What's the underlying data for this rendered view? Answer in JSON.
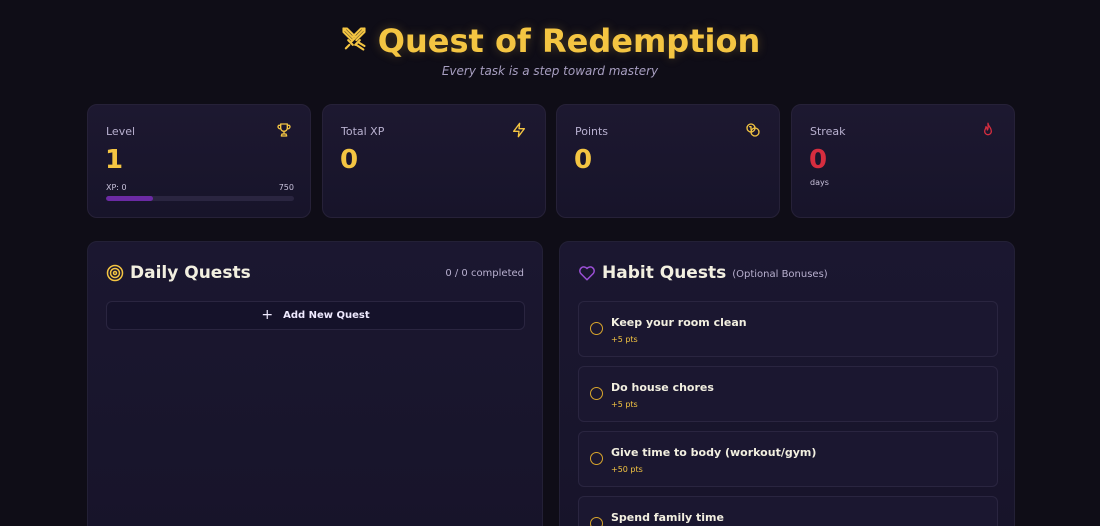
{
  "header": {
    "title": "Quest of Redemption",
    "subtitle": "Every task is a step toward mastery",
    "icon": "crossed-swords-icon"
  },
  "stats": {
    "level": {
      "label": "Level",
      "value": "1",
      "icon": "trophy-icon",
      "xp_label": "XP: 0",
      "xp_max": "750",
      "xp_progress": 0.25
    },
    "total_xp": {
      "label": "Total XP",
      "value": "0",
      "icon": "lightning-icon"
    },
    "points": {
      "label": "Points",
      "value": "0",
      "icon": "coins-icon"
    },
    "streak": {
      "label": "Streak",
      "value": "0",
      "unit": "days",
      "icon": "flame-icon"
    }
  },
  "daily": {
    "title": "Daily Quests",
    "icon": "target-icon",
    "completed": "0 / 0 completed",
    "add_label": "Add New Quest"
  },
  "habits": {
    "title": "Habit Quests",
    "note": "(Optional Bonuses)",
    "icon": "heart-icon",
    "items": [
      {
        "name": "Keep your room clean",
        "points": "+5 pts"
      },
      {
        "name": "Do house chores",
        "points": "+5 pts"
      },
      {
        "name": "Give time to body (workout/gym)",
        "points": "+50 pts"
      },
      {
        "name": "Spend family time",
        "points": ""
      }
    ]
  },
  "colors": {
    "accent": "#f4c542",
    "streak": "#d62d3f",
    "xp_bar": "#6b2aa4",
    "background": "#0f0d17"
  }
}
